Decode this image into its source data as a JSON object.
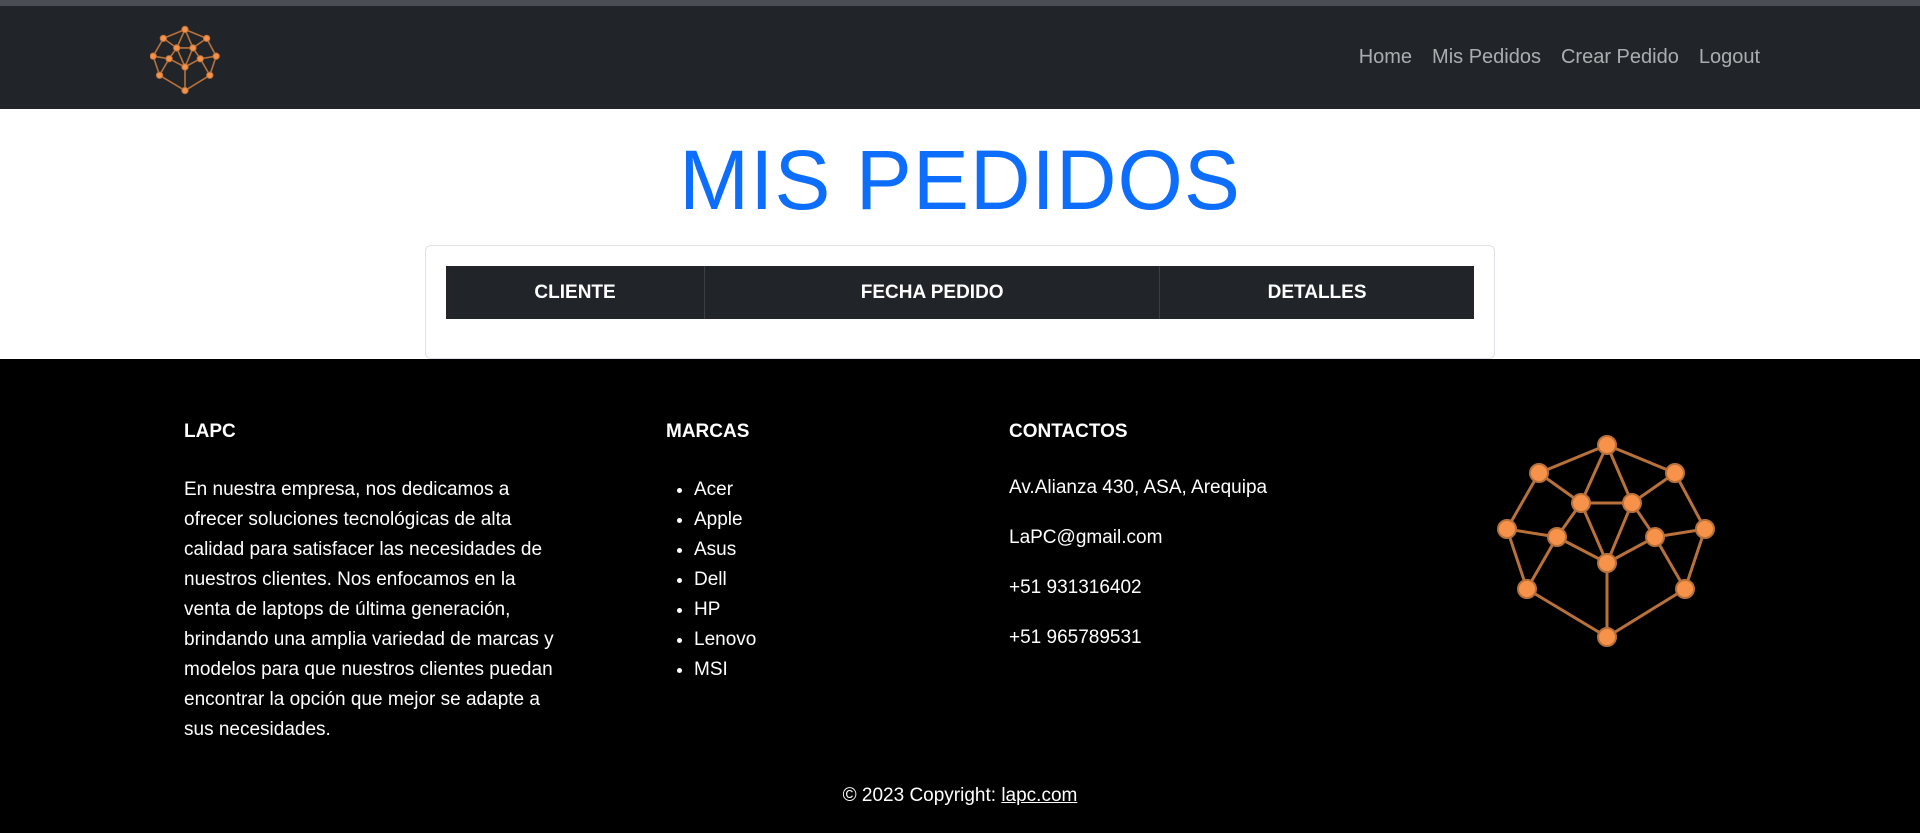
{
  "nav": {
    "logo_icon": "network-brain-logo",
    "links": [
      "Home",
      "Mis Pedidos",
      "Crear Pedido",
      "Logout"
    ]
  },
  "page": {
    "title": "MIS PEDIDOS"
  },
  "table": {
    "headers": [
      "CLIENTE",
      "FECHA PEDIDO",
      "DETALLES"
    ],
    "rows": []
  },
  "footer": {
    "about": {
      "heading": "LAPC",
      "text": "En nuestra empresa, nos dedicamos a ofrecer soluciones tecnológicas de alta calidad para satisfacer las necesidades de nuestros clientes. Nos enfocamos en la venta de laptops de última generación, brindando una amplia variedad de marcas y modelos para que nuestros clientes puedan encontrar la opción que mejor se adapte a sus necesidades."
    },
    "brands": {
      "heading": "MARCAS",
      "items": [
        "Acer",
        "Apple",
        "Asus",
        "Dell",
        "HP",
        "Lenovo",
        "MSI"
      ]
    },
    "contacts": {
      "heading": "CONTACTOS",
      "address": "Av.Alianza 430, ASA, Arequipa",
      "email": "LaPC@gmail.com",
      "phone1": "+51 931316402",
      "phone2": "+51 965789531"
    },
    "copyright_prefix": "© 2023 Copyright: ",
    "copyright_link": "lapc.com"
  },
  "colors": {
    "navbar_bg": "#212529",
    "title_blue": "#0d6efd",
    "logo_orange": "#f7924a",
    "footer_bg": "#000000"
  }
}
